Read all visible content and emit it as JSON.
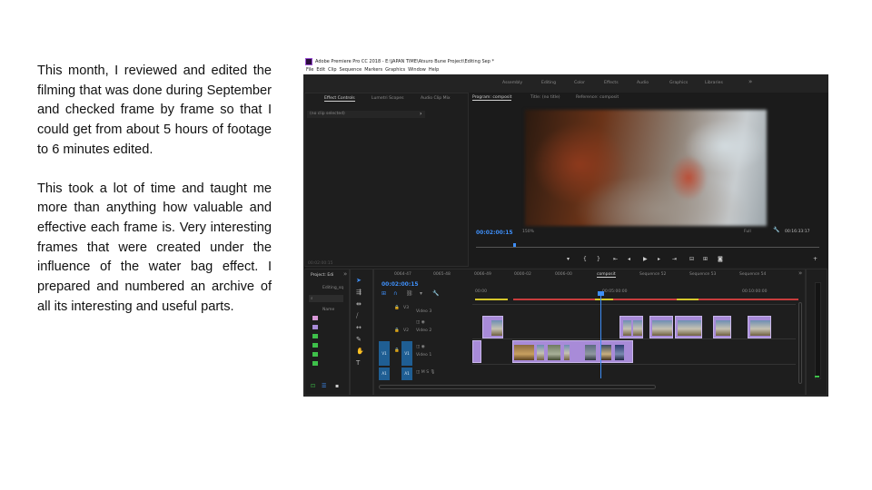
{
  "slide": {
    "paragraph1": "This month, I reviewed and edited the filming that was done during September and checked frame by frame so that I could get from about 5 hours of footage to 6 minutes edited.",
    "paragraph2": "This took a lot of time and taught me more than anything how valuable and effective each frame is. Very interesting frames that were created under the influence of the water bag effect. I prepared and numbered an archive of all its interesting and useful parts."
  },
  "app": {
    "title": "Adobe Premiere Pro CC 2018 - E:\\JAPAN TIME\\Atsuro Bune Project\\Editing Sep *",
    "menu": [
      "File",
      "Edit",
      "Clip",
      "Sequence",
      "Markers",
      "Graphics",
      "Window",
      "Help"
    ],
    "workspaces": [
      "Assembly",
      "Editing",
      "Color",
      "Effects",
      "Audio",
      "Graphics",
      "Libraries"
    ],
    "workspaces_more": "»",
    "source_panel": {
      "tabs": [
        "Effect Controls",
        "Lumetri Scopes",
        "Audio Clip Mix"
      ],
      "no_clip": "(no clip selected)",
      "timecode": "00:02:00:15"
    },
    "program_panel": {
      "tabs": [
        "Program: composit",
        "Title: (no title)",
        "Reference: composit"
      ],
      "timecode": "00:02:00:15",
      "zoom": "150%",
      "quality": "Full",
      "duration": "00:16:33:17"
    },
    "project_panel": {
      "tab": "Project: Edi",
      "item": "Editing_sq",
      "column": "Name"
    },
    "timeline": {
      "tabs": [
        "0064-47",
        "0065-48",
        "0066-49",
        "0000-02",
        "0006-00",
        "composit",
        "Sequence 52",
        "Sequence 53",
        "Sequence 54"
      ],
      "timecode": "00:02:00:15",
      "ruler": [
        "00:00",
        "00:05:00:00",
        "00:10:00:00"
      ],
      "tracks": {
        "v3": "Video 3",
        "v2": "Video 2",
        "v1": "Video 1",
        "v3_id": "V3",
        "v2_id": "V2",
        "v1_id": "V1",
        "a1_id": "A1"
      }
    },
    "colors": {
      "accent_blue": "#3e8ef7",
      "clip_purple": "#a88bd8",
      "track_blue": "#1f5e93"
    }
  }
}
